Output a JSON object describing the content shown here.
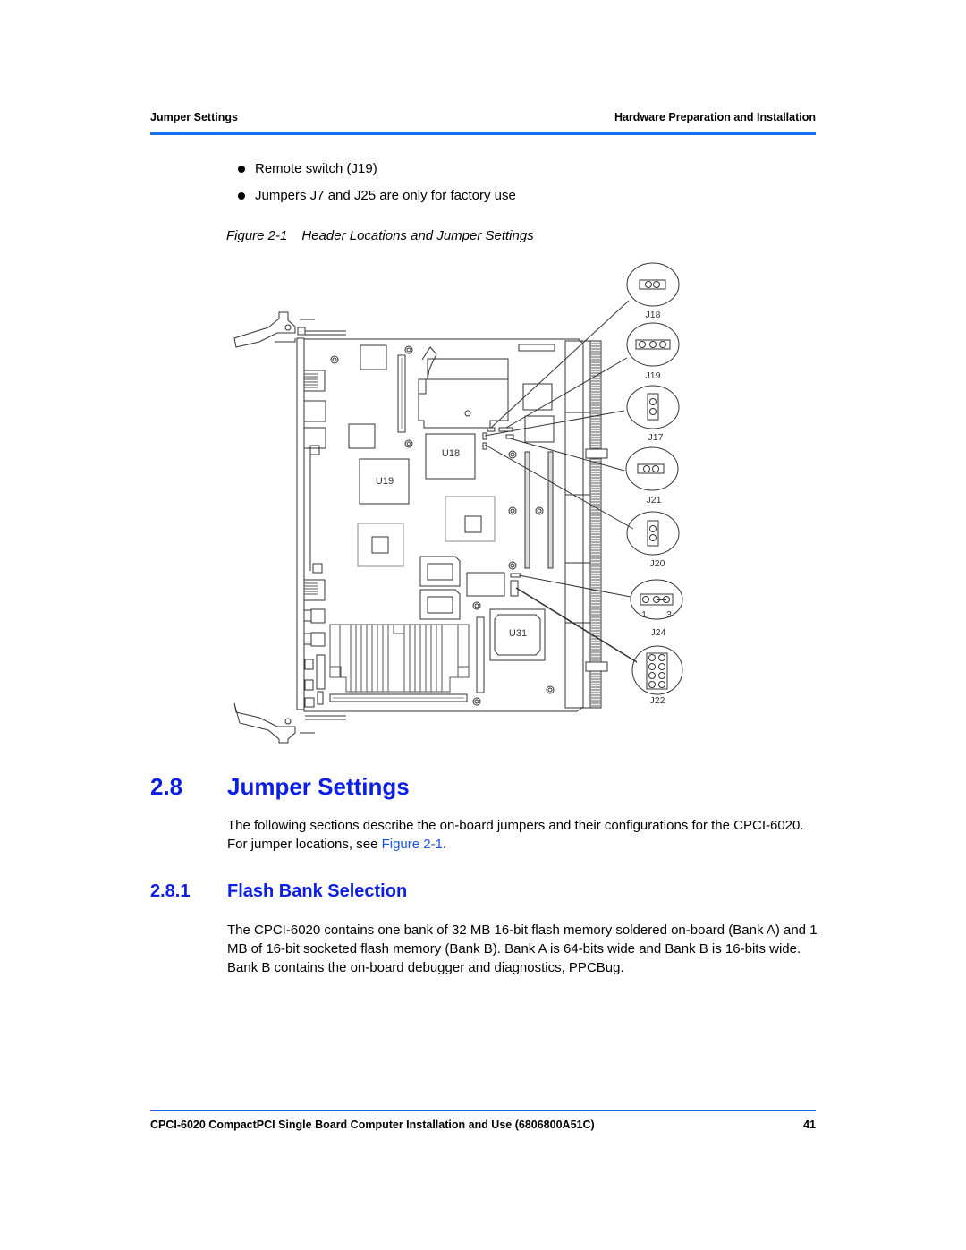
{
  "header": {
    "section": "Jumper Settings",
    "chapter": "Hardware Preparation and Installation",
    "rule_color": "#1a6cf0"
  },
  "bullets": [
    "Remote switch (J19)",
    "Jumpers J7 and J25 are only for factory use"
  ],
  "figure": {
    "number": "Figure 2-1",
    "title": "Header Locations and Jumper Settings",
    "chip_labels": [
      "U18",
      "U19",
      "U31"
    ],
    "callouts": [
      {
        "label": "J18",
        "pins": "2-pin horizontal"
      },
      {
        "label": "J19",
        "pins": "3-pin horizontal"
      },
      {
        "label": "J17",
        "pins": "2-pin vertical"
      },
      {
        "label": "J21",
        "pins": "2-pin horizontal"
      },
      {
        "label": "J20",
        "pins": "2-pin vertical"
      },
      {
        "label": "J24",
        "pins": "3-pin, jumper on 2-3",
        "pin_left": "1",
        "pin_right": "3"
      },
      {
        "label": "J22",
        "pins": "2x4 block"
      }
    ]
  },
  "section": {
    "number": "2.8",
    "title": "Jumper Settings",
    "intro_before_link": "The following sections describe the on-board jumpers and their configurations for the CPCI-6020. For jumper locations, see ",
    "intro_link": "Figure 2-1",
    "intro_after_link": ".",
    "heading_color": "#0b1ee6"
  },
  "subsection": {
    "number": "2.8.1",
    "title": "Flash Bank Selection",
    "body": "The CPCI-6020 contains one bank of 32 MB 16-bit flash memory soldered on-board (Bank A) and 1 MB of 16-bit socketed flash memory (Bank B). Bank A is 64-bits wide and Bank B is 16-bits wide. Bank B contains the on-board debugger and diagnostics, PPCBug."
  },
  "footer": {
    "title": "CPCI-6020 CompactPCI Single Board Computer Installation and Use (6806800A51C)",
    "page": "41"
  }
}
